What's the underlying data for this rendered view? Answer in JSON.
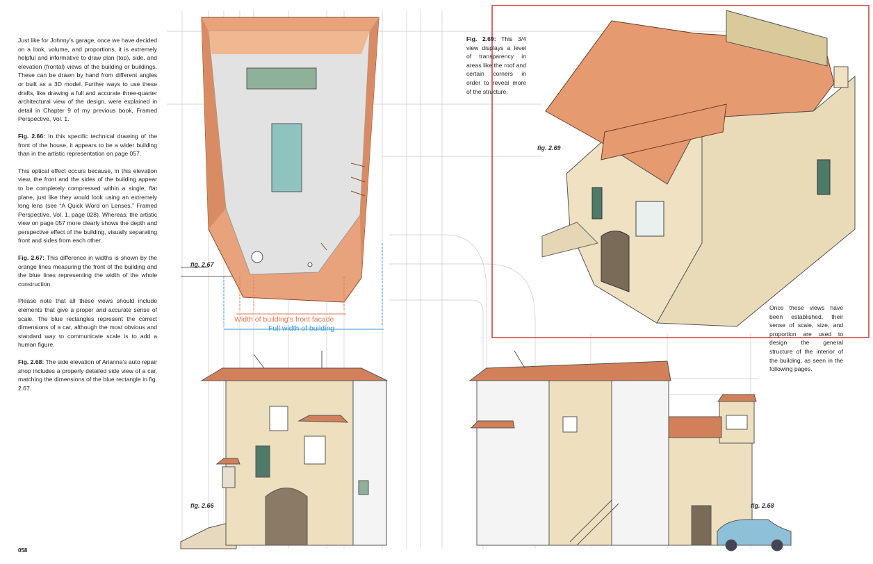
{
  "left_column": {
    "p1": "Just like for Johnny’s garage, once we have decided on a look, volume, and proportions, it is extremely helpful and informative to draw plan (top), side, and elevation (frontal) views of the building or buildings. These can be drawn by hand from different angles or built as a 3D model. Further ways to use these drafts, like drawing a full and accurate three-quarter architectural view of the design, were explained in detail in Chapter 9 of my previous book, Framed Perspective, Vol. 1.",
    "p2_lead": "Fig. 2.66:",
    "p2": " In this specific technical drawing of the front of the house, it appears to be a wider building than in the artistic representation on page 057.",
    "p3": "This optical effect occurs because, in this elevation view, the front and the sides of the building appear to be completely compressed within a single, flat plane, just like they would look using an extremely long lens (see “A Quick Word on Lenses,” Framed Perspective, Vol. 1, page 028). Whereas, the artistic view on page 057 more clearly shows the depth and perspective effect of the building, visually separating front and sides from each other.",
    "p4_lead": "Fig. 2.67:",
    "p4": " This difference in widths is shown by the orange lines measuring the front of the building and the blue lines representing the width of the whole construction.",
    "p5": "Please note that all these views should include elements that give a proper and accurate sense of scale. The blue rectangles represent the correct dimensions of a car, although the most obvious and standard way to communicate scale is to add a human figure.",
    "p6_lead": "Fig. 2.68:",
    "p6": " The side elevation of Arianna’s auto repair shop includes a properly detailed side view of a car, matching the dimensions of the blue rectangle in fig. 2.67."
  },
  "caption_269": {
    "lead": "Fig. 2.69:",
    "text": " This 3/4 view displays a level of transparency in areas like the roof and certain corners in order to reveal more of the structure."
  },
  "caption_right": "Once these views have been established, their sense of scale, size, and proportion are used to design the general structure of the interior of the building, as seen in the following pages.",
  "measure": {
    "orange_label": "Width of building’s front facade",
    "blue_label": "Full width of building"
  },
  "fig_labels": {
    "f267": "fig. 2.67",
    "f269": "fig. 2.69",
    "f266": "fig. 2.66",
    "f268": "fig. 2.68"
  },
  "page_number": "058",
  "colors": {
    "roof_orange": "#e59a70",
    "plan_orange": "#e8a27c",
    "blue": "#3a9bd3",
    "frame_red": "#c2302a",
    "stone": "#eedfbf",
    "teal": "#8fc3bf"
  }
}
